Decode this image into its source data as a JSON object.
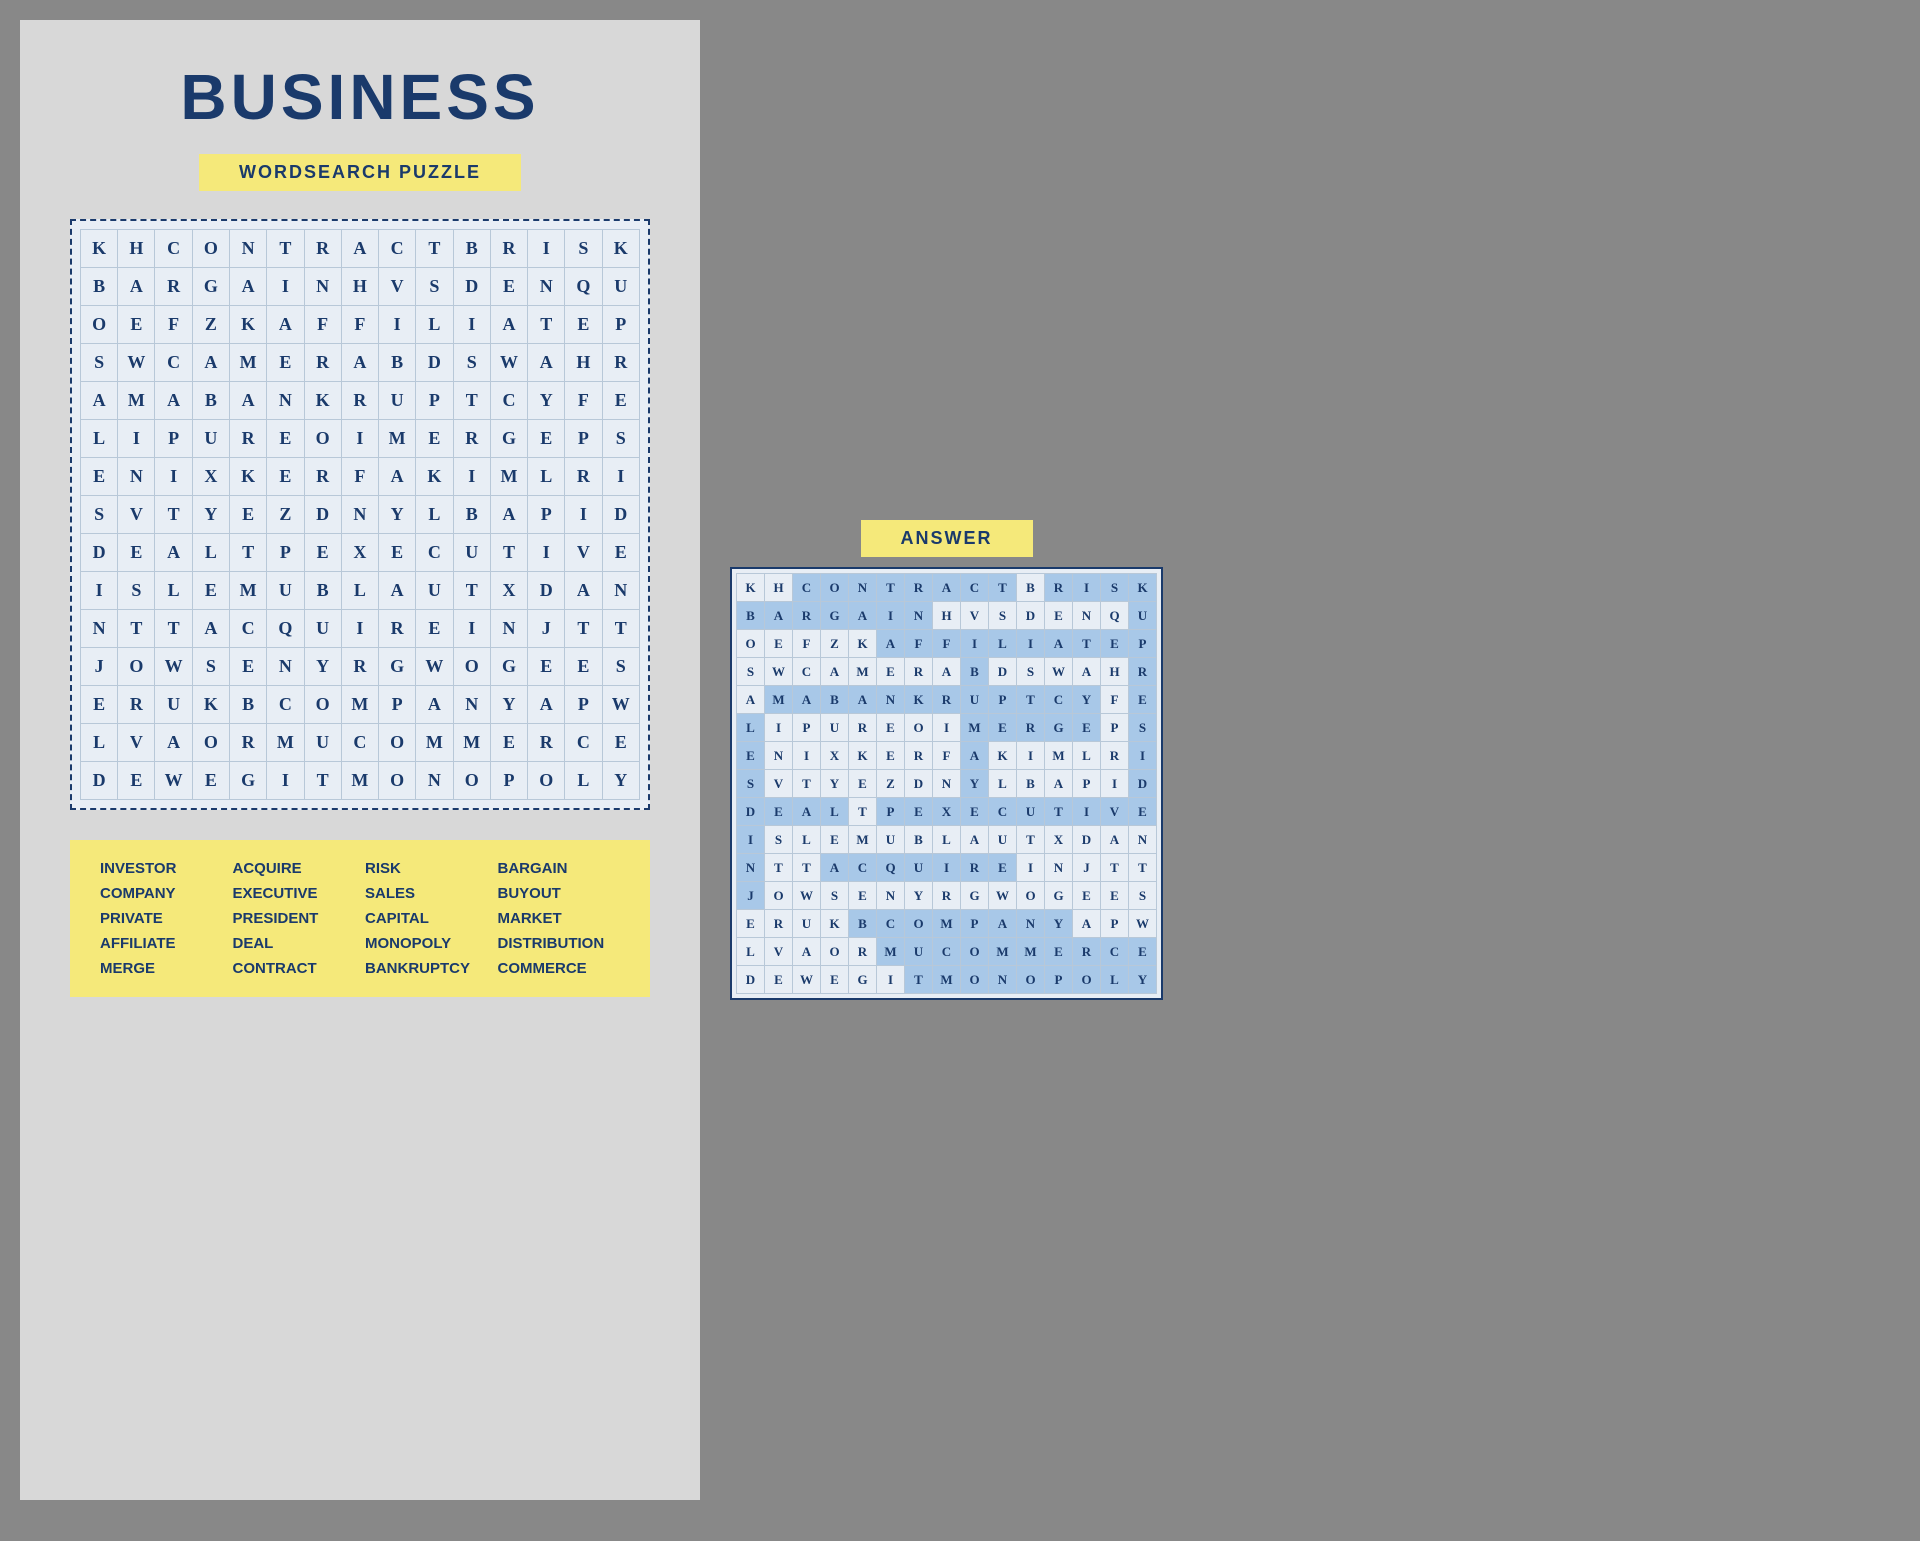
{
  "leftPage": {
    "title": "BUSINESS",
    "subtitle": "WORDSEARCH PUZZLE",
    "grid": [
      [
        "K",
        "H",
        "C",
        "O",
        "N",
        "T",
        "R",
        "A",
        "C",
        "T",
        "B",
        "R",
        "I",
        "S",
        "K"
      ],
      [
        "B",
        "A",
        "R",
        "G",
        "A",
        "I",
        "N",
        "H",
        "V",
        "S",
        "D",
        "E",
        "N",
        "Q",
        "U"
      ],
      [
        "O",
        "E",
        "F",
        "Z",
        "K",
        "A",
        "F",
        "F",
        "I",
        "L",
        "I",
        "A",
        "T",
        "E",
        "P"
      ],
      [
        "S",
        "W",
        "C",
        "A",
        "M",
        "E",
        "R",
        "A",
        "B",
        "D",
        "S",
        "W",
        "A",
        "H",
        "R"
      ],
      [
        "A",
        "M",
        "A",
        "B",
        "A",
        "N",
        "K",
        "R",
        "U",
        "P",
        "T",
        "C",
        "Y",
        "F",
        "E"
      ],
      [
        "L",
        "I",
        "P",
        "U",
        "R",
        "E",
        "O",
        "I",
        "M",
        "E",
        "R",
        "G",
        "E",
        "P",
        "S"
      ],
      [
        "E",
        "N",
        "I",
        "X",
        "K",
        "E",
        "R",
        "F",
        "A",
        "K",
        "I",
        "M",
        "L",
        "R",
        "I"
      ],
      [
        "S",
        "V",
        "T",
        "Y",
        "E",
        "Z",
        "D",
        "N",
        "Y",
        "L",
        "B",
        "A",
        "P",
        "I",
        "D"
      ],
      [
        "D",
        "E",
        "A",
        "L",
        "T",
        "P",
        "E",
        "X",
        "E",
        "C",
        "U",
        "T",
        "I",
        "V",
        "E"
      ],
      [
        "I",
        "S",
        "L",
        "E",
        "M",
        "U",
        "B",
        "L",
        "A",
        "U",
        "T",
        "X",
        "D",
        "A",
        "N"
      ],
      [
        "N",
        "T",
        "T",
        "A",
        "C",
        "Q",
        "U",
        "I",
        "R",
        "E",
        "I",
        "N",
        "J",
        "T",
        "T"
      ],
      [
        "J",
        "O",
        "W",
        "S",
        "E",
        "N",
        "Y",
        "R",
        "G",
        "W",
        "O",
        "G",
        "E",
        "E",
        "S"
      ],
      [
        "E",
        "R",
        "U",
        "K",
        "B",
        "C",
        "O",
        "M",
        "P",
        "A",
        "N",
        "Y",
        "A",
        "P",
        "W"
      ],
      [
        "L",
        "V",
        "A",
        "O",
        "R",
        "M",
        "U",
        "C",
        "O",
        "M",
        "M",
        "E",
        "R",
        "C",
        "E"
      ],
      [
        "D",
        "E",
        "W",
        "E",
        "G",
        "I",
        "T",
        "M",
        "O",
        "N",
        "O",
        "P",
        "O",
        "L",
        "Y"
      ]
    ],
    "wordList": [
      "INVESTOR",
      "ACQUIRE",
      "RISK",
      "BARGAIN",
      "COMPANY",
      "EXECUTIVE",
      "SALES",
      "BUYOUT",
      "PRIVATE",
      "PRESIDENT",
      "CAPITAL",
      "MARKET",
      "AFFILIATE",
      "DEAL",
      "MONOPOLY",
      "DISTRIBUTION",
      "MERGE",
      "CONTRACT",
      "BANKRUPTCY",
      "COMMERCE"
    ]
  },
  "answerPage": {
    "title": "ANSWER",
    "grid": [
      [
        "K",
        "H",
        "C",
        "O",
        "N",
        "T",
        "R",
        "A",
        "C",
        "T",
        "B",
        "R",
        "I",
        "S",
        "K"
      ],
      [
        "B",
        "A",
        "R",
        "G",
        "A",
        "I",
        "N",
        "H",
        "V",
        "S",
        "D",
        "E",
        "N",
        "Q",
        "U"
      ],
      [
        "O",
        "E",
        "F",
        "Z",
        "K",
        "A",
        "F",
        "F",
        "I",
        "L",
        "I",
        "A",
        "T",
        "E",
        "P"
      ],
      [
        "S",
        "W",
        "C",
        "A",
        "M",
        "E",
        "R",
        "A",
        "B",
        "D",
        "S",
        "W",
        "A",
        "H",
        "R"
      ],
      [
        "A",
        "M",
        "A",
        "B",
        "A",
        "N",
        "K",
        "R",
        "U",
        "P",
        "T",
        "C",
        "Y",
        "F",
        "E"
      ],
      [
        "L",
        "I",
        "P",
        "U",
        "R",
        "E",
        "O",
        "I",
        "M",
        "E",
        "R",
        "G",
        "E",
        "P",
        "S"
      ],
      [
        "E",
        "N",
        "I",
        "X",
        "K",
        "E",
        "R",
        "F",
        "A",
        "K",
        "I",
        "M",
        "L",
        "R",
        "I"
      ],
      [
        "S",
        "V",
        "T",
        "Y",
        "E",
        "Z",
        "D",
        "N",
        "Y",
        "L",
        "B",
        "A",
        "P",
        "I",
        "D"
      ],
      [
        "D",
        "E",
        "A",
        "L",
        "T",
        "P",
        "E",
        "X",
        "E",
        "C",
        "U",
        "T",
        "I",
        "V",
        "E"
      ],
      [
        "I",
        "S",
        "L",
        "E",
        "M",
        "U",
        "B",
        "L",
        "A",
        "U",
        "T",
        "X",
        "D",
        "A",
        "N"
      ],
      [
        "N",
        "T",
        "T",
        "A",
        "C",
        "Q",
        "U",
        "I",
        "R",
        "E",
        "I",
        "N",
        "J",
        "T",
        "T"
      ],
      [
        "J",
        "O",
        "W",
        "S",
        "E",
        "N",
        "Y",
        "R",
        "G",
        "W",
        "O",
        "G",
        "E",
        "E",
        "S"
      ],
      [
        "E",
        "R",
        "U",
        "K",
        "B",
        "C",
        "O",
        "M",
        "P",
        "A",
        "N",
        "Y",
        "A",
        "P",
        "W"
      ],
      [
        "L",
        "V",
        "A",
        "O",
        "R",
        "M",
        "U",
        "C",
        "O",
        "M",
        "M",
        "E",
        "R",
        "C",
        "E"
      ],
      [
        "D",
        "E",
        "W",
        "E",
        "G",
        "I",
        "T",
        "M",
        "O",
        "N",
        "O",
        "P",
        "O",
        "L",
        "Y"
      ]
    ],
    "highlights": {
      "contract": [
        [
          0,
          2
        ],
        [
          0,
          3
        ],
        [
          0,
          4
        ],
        [
          0,
          5
        ],
        [
          0,
          6
        ],
        [
          0,
          7
        ],
        [
          0,
          8
        ],
        [
          0,
          9
        ]
      ],
      "risk": [
        [
          0,
          11
        ],
        [
          0,
          12
        ],
        [
          0,
          13
        ],
        [
          0,
          14
        ]
      ],
      "bargain": [
        [
          1,
          0
        ],
        [
          1,
          1
        ],
        [
          1,
          2
        ],
        [
          1,
          3
        ],
        [
          1,
          4
        ],
        [
          1,
          5
        ],
        [
          1,
          6
        ]
      ],
      "affiliate": [
        [
          2,
          5
        ],
        [
          2,
          6
        ],
        [
          2,
          7
        ],
        [
          2,
          8
        ],
        [
          2,
          9
        ],
        [
          2,
          10
        ],
        [
          2,
          11
        ],
        [
          2,
          12
        ],
        [
          2,
          13
        ]
      ],
      "bankrupt": [
        [
          4,
          1
        ],
        [
          4,
          2
        ],
        [
          4,
          3
        ],
        [
          4,
          4
        ],
        [
          4,
          5
        ],
        [
          4,
          6
        ],
        [
          4,
          7
        ],
        [
          4,
          8
        ],
        [
          4,
          9
        ],
        [
          4,
          10
        ],
        [
          4,
          11
        ],
        [
          4,
          12
        ]
      ],
      "merge": [
        [
          5,
          8
        ],
        [
          5,
          9
        ],
        [
          5,
          10
        ],
        [
          5,
          11
        ],
        [
          5,
          12
        ]
      ],
      "executive": [
        [
          8,
          4
        ],
        [
          8,
          5
        ],
        [
          8,
          6
        ],
        [
          8,
          7
        ],
        [
          8,
          8
        ],
        [
          8,
          9
        ],
        [
          8,
          10
        ],
        [
          8,
          11
        ],
        [
          8,
          12
        ],
        [
          8,
          13
        ],
        [
          8,
          14
        ]
      ],
      "acquire": [
        [
          10,
          3
        ],
        [
          10,
          4
        ],
        [
          10,
          5
        ],
        [
          10,
          6
        ],
        [
          10,
          7
        ],
        [
          10,
          8
        ],
        [
          10,
          9
        ]
      ],
      "company": [
        [
          12,
          4
        ],
        [
          12,
          5
        ],
        [
          12,
          6
        ],
        [
          12,
          7
        ],
        [
          12,
          8
        ],
        [
          12,
          9
        ],
        [
          12,
          10
        ],
        [
          12,
          11
        ]
      ],
      "commerce": [
        [
          13,
          5
        ],
        [
          13,
          6
        ],
        [
          13,
          7
        ],
        [
          13,
          8
        ],
        [
          13,
          9
        ],
        [
          13,
          10
        ],
        [
          13,
          11
        ],
        [
          13,
          12
        ],
        [
          13,
          13
        ],
        [
          13,
          14
        ]
      ],
      "deal": [
        [
          8,
          0
        ],
        [
          8,
          1
        ],
        [
          8,
          2
        ],
        [
          8,
          3
        ]
      ],
      "capital_col": [
        [
          1,
          8
        ],
        [
          2,
          8
        ],
        [
          3,
          8
        ],
        [
          4,
          8
        ],
        [
          5,
          8
        ],
        [
          6,
          8
        ],
        [
          7,
          8
        ]
      ],
      "sales_col": [
        [
          0,
          0
        ],
        [
          1,
          0
        ],
        [
          2,
          0
        ],
        [
          3,
          0
        ],
        [
          4,
          0
        ],
        [
          5,
          0
        ],
        [
          6,
          0
        ]
      ],
      "monopoly": [
        [
          14,
          6
        ],
        [
          14,
          7
        ],
        [
          14,
          8
        ],
        [
          14,
          9
        ],
        [
          14,
          10
        ],
        [
          14,
          11
        ],
        [
          14,
          12
        ],
        [
          14,
          13
        ],
        [
          14,
          14
        ]
      ]
    }
  }
}
